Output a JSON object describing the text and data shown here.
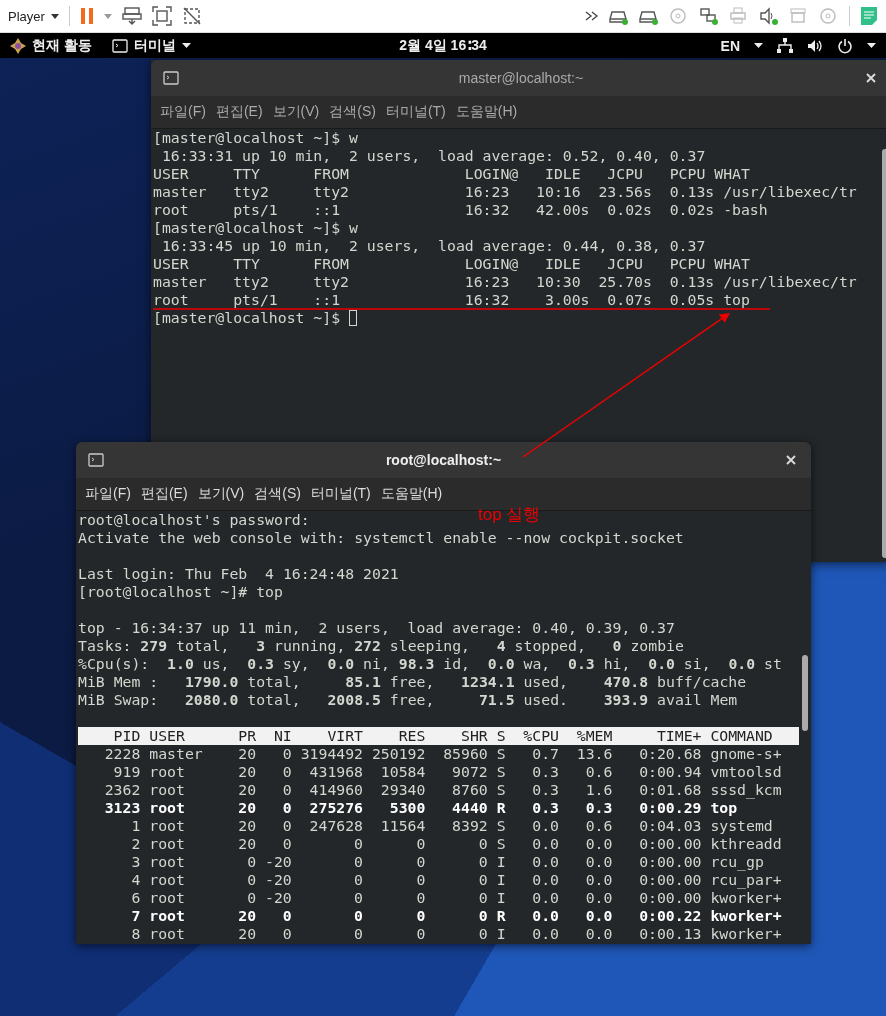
{
  "player_bar": {
    "menu": "Player",
    "devices": [
      {
        "kind": "drive",
        "connected": true
      },
      {
        "kind": "drive",
        "connected": true
      },
      {
        "kind": "disc",
        "connected": false
      },
      {
        "kind": "network",
        "connected": true
      },
      {
        "kind": "printer",
        "connected": false
      },
      {
        "kind": "sound",
        "connected": true
      },
      {
        "kind": "box",
        "connected": false
      },
      {
        "kind": "disc",
        "connected": false
      }
    ]
  },
  "top_bar": {
    "activities": "현재 활동",
    "app_menu": "터미널",
    "clock": "2월 4일 16∶34",
    "input_source": "EN"
  },
  "windows": [
    {
      "title": "master@localhost:~",
      "focused": false,
      "menu": [
        "파일(F)",
        "편집(E)",
        "보기(V)",
        "검색(S)",
        "터미널(T)",
        "도움말(H)"
      ],
      "blocks": [
        [
          "[master@localhost ~]$ w",
          " 16:33:31 up 10 min,  2 users,  load average: 0.52, 0.40, 0.37",
          "USER     TTY      FROM             LOGIN@   IDLE   JCPU   PCPU WHAT",
          "master   tty2     tty2             16:23   10:16  23.56s  0.13s /usr/libexec/tr",
          "root     pts/1    ::1              16:32   42.00s  0.02s  0.02s -bash",
          "[master@localhost ~]$ w",
          " 16:33:45 up 10 min,  2 users,  load average: 0.44, 0.38, 0.37",
          "USER     TTY      FROM             LOGIN@   IDLE   JCPU   PCPU WHAT",
          "master   tty2     tty2             16:23   10:30  25.70s  0.13s /usr/libexec/tr",
          "root     pts/1    ::1              16:32    3.00s  0.07s  0.05s top"
        ]
      ],
      "prompt": "[master@localhost ~]$"
    },
    {
      "title": "root@localhost:~",
      "focused": true,
      "menu": [
        "파일(F)",
        "편집(E)",
        "보기(V)",
        "검색(S)",
        "터미널(T)",
        "도움말(H)"
      ],
      "blocks": [
        [
          "root@localhost's password:",
          "Activate the web console with: systemctl enable --now cockpit.socket"
        ],
        [
          "Last login: Thu Feb  4 16:24:48 2021",
          "[root@localhost ~]# top"
        ],
        [
          "top - 16:34:37 up 11 min,  2 users,  load average: 0.40, 0.39, 0.37",
          "Tasks: **279** total,   **3** running, **272** sleeping,   **4** stopped,   **0** zombie",
          "%Cpu(s):  **1.0** us,  **0.3** sy,  **0.0** ni, **98.3** id,  **0.0** wa,  **0.3** hi,  **0.0** si,  **0.0** st",
          "MiB Mem :   **1790.0** total,     **85.1** free,   **1234.1** used,    **470.8** buff/cache",
          "MiB Swap:   **2080.0** total,   **2008.5** free,     **71.5** used.    **393.9** avail Mem"
        ]
      ],
      "process_table": {
        "columns": [
          "PID",
          "USER",
          "PR",
          "NI",
          "VIRT",
          "RES",
          "SHR",
          "S",
          "%CPU",
          "%MEM",
          "TIME+",
          "COMMAND"
        ],
        "rows": [
          {
            "highlighted": false,
            "cells": [
              "2228",
              "master",
              "20",
              "0",
              "3194492",
              "250192",
              "85960",
              "S",
              "0.7",
              "13.6",
              "0:20.68",
              "gnome-s+"
            ]
          },
          {
            "highlighted": false,
            "cells": [
              "919",
              "root",
              "20",
              "0",
              "431968",
              "10584",
              "9072",
              "S",
              "0.3",
              "0.6",
              "0:00.94",
              "vmtoolsd"
            ]
          },
          {
            "highlighted": false,
            "cells": [
              "2362",
              "root",
              "20",
              "0",
              "414960",
              "29340",
              "8760",
              "S",
              "0.3",
              "1.6",
              "0:01.68",
              "sssd_kcm"
            ]
          },
          {
            "highlighted": true,
            "cells": [
              "3123",
              "root",
              "20",
              "0",
              "275276",
              "5300",
              "4440",
              "R",
              "0.3",
              "0.3",
              "0:00.29",
              "top"
            ]
          },
          {
            "highlighted": false,
            "cells": [
              "1",
              "root",
              "20",
              "0",
              "247628",
              "11564",
              "8392",
              "S",
              "0.0",
              "0.6",
              "0:04.03",
              "systemd"
            ]
          },
          {
            "highlighted": false,
            "cells": [
              "2",
              "root",
              "20",
              "0",
              "0",
              "0",
              "0",
              "S",
              "0.0",
              "0.0",
              "0:00.00",
              "kthreadd"
            ]
          },
          {
            "highlighted": false,
            "cells": [
              "3",
              "root",
              "0",
              "-20",
              "0",
              "0",
              "0",
              "I",
              "0.0",
              "0.0",
              "0:00.00",
              "rcu_gp"
            ]
          },
          {
            "highlighted": false,
            "cells": [
              "4",
              "root",
              "0",
              "-20",
              "0",
              "0",
              "0",
              "I",
              "0.0",
              "0.0",
              "0:00.00",
              "rcu_par+"
            ]
          },
          {
            "highlighted": false,
            "cells": [
              "6",
              "root",
              "0",
              "-20",
              "0",
              "0",
              "0",
              "I",
              "0.0",
              "0.0",
              "0:00.00",
              "kworker+"
            ]
          },
          {
            "highlighted": true,
            "cells": [
              "7",
              "root",
              "20",
              "0",
              "0",
              "0",
              "0",
              "R",
              "0.0",
              "0.0",
              "0:00.22",
              "kworker+"
            ]
          },
          {
            "highlighted": false,
            "cells": [
              "8",
              "root",
              "20",
              "0",
              "0",
              "0",
              "0",
              "I",
              "0.0",
              "0.0",
              "0:00.13",
              "kworker+"
            ]
          }
        ]
      }
    }
  ],
  "annotation": {
    "label": "top 실행"
  }
}
